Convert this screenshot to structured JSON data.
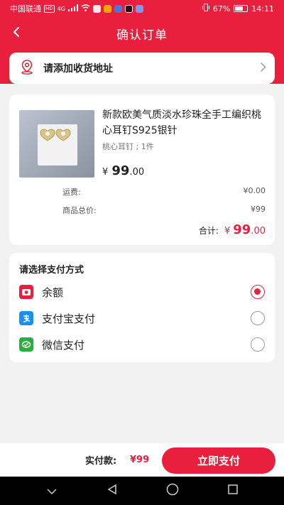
{
  "status_bar": {
    "carrier": "中国联通",
    "hd": "HD",
    "network": "4G",
    "battery": "67%",
    "time": "14:11"
  },
  "header": {
    "title": "确认订单",
    "back_icon": "chevron-left-icon"
  },
  "address": {
    "placeholder": "请添加收货地址",
    "icon": "location-pin-icon"
  },
  "order": {
    "product_name": "新款欧美气质淡水珍珠全手工编织桃心耳钉S925银针",
    "spec": "桃心耳钉 ; 1件",
    "price_symbol": "¥",
    "price_int": "99",
    "price_dec": ".00",
    "shipping_label": "运费:",
    "shipping_value": "¥0.00",
    "subtotal_label": "商品总价:",
    "subtotal_value": "¥99",
    "total_label": "合计:",
    "total_symbol": "¥",
    "total_int": "99",
    "total_dec": ".00"
  },
  "payment": {
    "title": "请选择支付方式",
    "methods": [
      {
        "label": "余额",
        "icon": "wallet-icon",
        "color": "#e8203e",
        "selected": true
      },
      {
        "label": "支付宝支付",
        "icon": "alipay-icon",
        "color": "#1a8ff0",
        "selected": false
      },
      {
        "label": "微信支付",
        "icon": "wechat-pay-icon",
        "color": "#2aae3e",
        "selected": false
      }
    ]
  },
  "footer": {
    "actual_label": "实付款:",
    "actual_value": "¥99",
    "pay_button": "立即支付"
  },
  "colors": {
    "accent": "#e8203e",
    "background": "#f2f2f2"
  }
}
